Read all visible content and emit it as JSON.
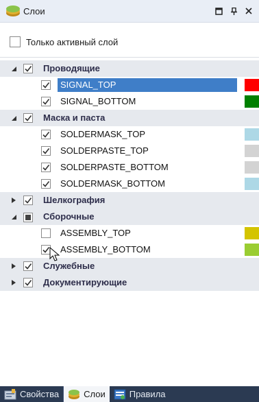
{
  "window": {
    "title": "Слои",
    "buttons": [
      {
        "name": "restore",
        "glyph": "□"
      },
      {
        "name": "pin",
        "glyph": "⊥"
      },
      {
        "name": "close",
        "glyph": "✕"
      }
    ]
  },
  "active_only": {
    "label": "Только активный слой",
    "checked": false
  },
  "groups": [
    {
      "label": "Проводящие",
      "expanded": true,
      "state": "checked",
      "layers": [
        {
          "label": "SIGNAL_TOP",
          "checked": true,
          "color": "#ff0000",
          "selected": true
        },
        {
          "label": "SIGNAL_BOTTOM",
          "checked": true,
          "color": "#008000",
          "selected": false
        }
      ]
    },
    {
      "label": "Маска и паста",
      "expanded": true,
      "state": "checked",
      "layers": [
        {
          "label": "SOLDERMASK_TOP",
          "checked": true,
          "color": "#add8e6",
          "selected": false
        },
        {
          "label": "SOLDERPASTE_TOP",
          "checked": true,
          "color": "#d3d3d3",
          "selected": false
        },
        {
          "label": "SOLDERPASTE_BOTTOM",
          "checked": true,
          "color": "#d3d3d3",
          "selected": false
        },
        {
          "label": "SOLDERMASK_BOTTOM",
          "checked": true,
          "color": "#add8e6",
          "selected": false
        }
      ]
    },
    {
      "label": "Шелкография",
      "expanded": false,
      "state": "checked",
      "layers": []
    },
    {
      "label": "Сборочные",
      "expanded": true,
      "state": "indeterminate",
      "layers": [
        {
          "label": "ASSEMBLY_TOP",
          "checked": false,
          "color": "#d4c400",
          "selected": false
        },
        {
          "label": "ASSEMBLY_BOTTOM",
          "checked": true,
          "color": "#9acd32",
          "selected": false
        }
      ]
    },
    {
      "label": "Служебные",
      "expanded": false,
      "state": "checked",
      "layers": []
    },
    {
      "label": "Документирующие",
      "expanded": false,
      "state": "checked",
      "layers": []
    }
  ],
  "tabs": [
    {
      "label": "Свойства",
      "icon": "properties-icon",
      "active": false
    },
    {
      "label": "Слои",
      "icon": "layers-icon",
      "active": true
    },
    {
      "label": "Правила",
      "icon": "rules-icon",
      "active": false
    }
  ]
}
